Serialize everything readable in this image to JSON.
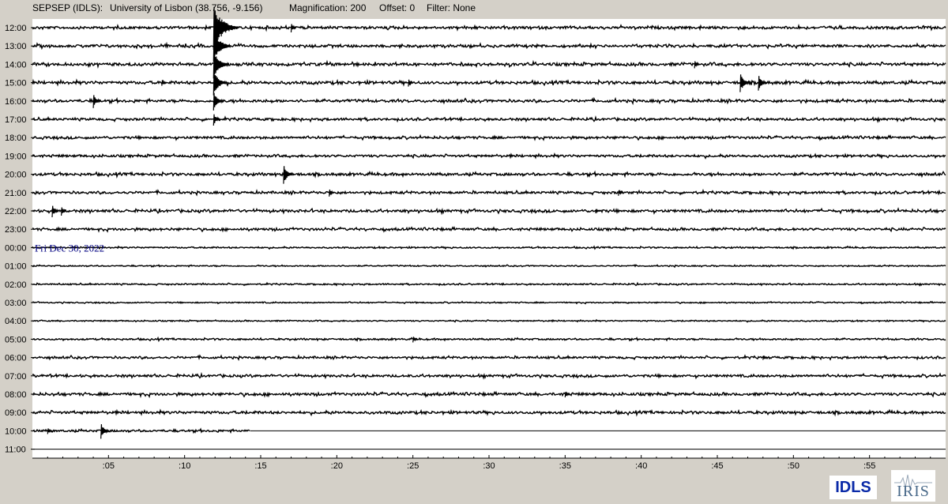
{
  "header": {
    "station": "SEPSEP (IDLS):",
    "location": "University of Lisbon (38.756, -9.156)",
    "magnification": "Magnification: 200",
    "offset": "Offset: 0",
    "filter": "Filter: None"
  },
  "chart_data": {
    "type": "helicorder",
    "hour_labels": [
      "12:00",
      "13:00",
      "14:00",
      "15:00",
      "16:00",
      "17:00",
      "18:00",
      "19:00",
      "20:00",
      "21:00",
      "22:00",
      "23:00",
      "00:00",
      "01:00",
      "02:00",
      "03:00",
      "04:00",
      "05:00",
      "06:00",
      "07:00",
      "08:00",
      "09:00",
      "10:00",
      "11:00"
    ],
    "minute_ticks": [
      ":05",
      ":10",
      ":15",
      ":20",
      ":25",
      ":30",
      ":35",
      ":40",
      ":45",
      ":50",
      ":55"
    ],
    "date_annotation": "Fri Dec 30, 2022",
    "date_row": "00:00",
    "data_end": {
      "row": "10:00",
      "minute": 14.3
    },
    "trace_amplitude": [
      0.55,
      0.55,
      0.6,
      0.6,
      0.55,
      0.5,
      0.5,
      0.5,
      0.55,
      0.5,
      0.55,
      0.5,
      0.3,
      0.25,
      0.3,
      0.25,
      0.25,
      0.35,
      0.45,
      0.5,
      0.55,
      0.55,
      0.45,
      0
    ],
    "events": [
      {
        "row": "12:00",
        "minute": 17.0,
        "amplitude": 6
      },
      {
        "row": "12:00",
        "minute": 11.9,
        "amplitude": 28
      },
      {
        "row": "13:00",
        "minute": 11.9,
        "amplitude": 20
      },
      {
        "row": "14:00",
        "minute": 11.9,
        "amplitude": 18
      },
      {
        "row": "14:00",
        "minute": 43.5,
        "amplitude": 5
      },
      {
        "row": "15:00",
        "minute": 11.9,
        "amplitude": 16
      },
      {
        "row": "15:00",
        "minute": 46.5,
        "amplitude": 12
      },
      {
        "row": "15:00",
        "minute": 47.7,
        "amplitude": 10
      },
      {
        "row": "15:00",
        "minute": 8.5,
        "amplitude": 4
      },
      {
        "row": "15:00",
        "minute": 24.7,
        "amplitude": 5
      },
      {
        "row": "16:00",
        "minute": 4.0,
        "amplitude": 9
      },
      {
        "row": "16:00",
        "minute": 11.9,
        "amplitude": 12
      },
      {
        "row": "17:00",
        "minute": 11.9,
        "amplitude": 8
      },
      {
        "row": "20:00",
        "minute": 16.5,
        "amplitude": 12
      },
      {
        "row": "21:00",
        "minute": 19.5,
        "amplitude": 5
      },
      {
        "row": "21:00",
        "minute": 38.5,
        "amplitude": 4
      },
      {
        "row": "22:00",
        "minute": 1.3,
        "amplitude": 8
      },
      {
        "row": "22:00",
        "minute": 1.9,
        "amplitude": 6
      },
      {
        "row": "22:00",
        "minute": 37.0,
        "amplitude": 3
      },
      {
        "row": "05:00",
        "minute": 25.0,
        "amplitude": 4
      },
      {
        "row": "06:00",
        "minute": 48.0,
        "amplitude": 3
      },
      {
        "row": "08:00",
        "minute": 35.0,
        "amplitude": 4
      },
      {
        "row": "10:00",
        "minute": 4.5,
        "amplitude": 10
      },
      {
        "row": "10:00",
        "minute": 1.0,
        "amplitude": 4
      }
    ],
    "colors": {
      "trace": "#000000",
      "background": "#ffffff",
      "frame": "#d4d0c8",
      "date_text": "#000080"
    }
  },
  "logos": {
    "idls": "IDLS",
    "iris": "IRIS"
  }
}
